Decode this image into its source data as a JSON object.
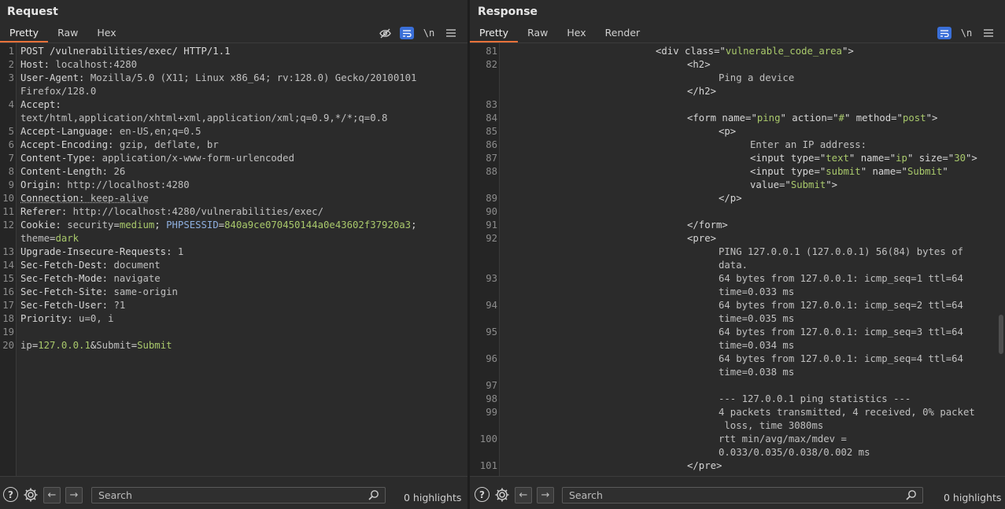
{
  "request": {
    "title": "Request",
    "tabs": [
      "Pretty",
      "Raw",
      "Hex"
    ],
    "tools": [
      "eye-slash",
      "wrap",
      "\\n",
      "menu"
    ],
    "lines": [
      {
        "n": "1",
        "parts": [
          [
            "k",
            "POST /vulnerabilities/exec/ HTTP/1.1"
          ]
        ]
      },
      {
        "n": "2",
        "parts": [
          [
            "k",
            "Host: "
          ],
          [
            "v",
            "localhost:4280"
          ]
        ]
      },
      {
        "n": "3",
        "parts": [
          [
            "k",
            "User-Agent: "
          ],
          [
            "v",
            "Mozilla/5.0 (X11; Linux x86_64; rv:128.0) Gecko/20100101"
          ]
        ]
      },
      {
        "n": "",
        "parts": [
          [
            "v",
            "Firefox/128.0"
          ]
        ]
      },
      {
        "n": "4",
        "parts": [
          [
            "k",
            "Accept: "
          ]
        ]
      },
      {
        "n": "",
        "parts": [
          [
            "v",
            "text/html,application/xhtml+xml,application/xml;q=0.9,*/*;q=0.8"
          ]
        ]
      },
      {
        "n": "5",
        "parts": [
          [
            "k",
            "Accept-Language: "
          ],
          [
            "v",
            "en-US,en;q=0.5"
          ]
        ]
      },
      {
        "n": "6",
        "parts": [
          [
            "k",
            "Accept-Encoding: "
          ],
          [
            "v",
            "gzip, deflate, br"
          ]
        ]
      },
      {
        "n": "7",
        "parts": [
          [
            "k",
            "Content-Type: "
          ],
          [
            "v",
            "application/x-www-form-urlencoded"
          ]
        ]
      },
      {
        "n": "8",
        "parts": [
          [
            "k",
            "Content-Length: "
          ],
          [
            "v",
            "26"
          ]
        ]
      },
      {
        "n": "9",
        "parts": [
          [
            "k",
            "Origin: "
          ],
          [
            "v",
            "http://localhost:4280"
          ]
        ]
      },
      {
        "n": "10",
        "parts": [
          [
            "k",
            "Connection: "
          ],
          [
            "v",
            "keep-alive"
          ]
        ]
      },
      {
        "n": "11",
        "parts": [
          [
            "k",
            "Referer: "
          ],
          [
            "v",
            "http://localhost:4280/vulnerabilities/exec/"
          ]
        ]
      },
      {
        "n": "12",
        "parts": [
          [
            "k",
            "Cookie: "
          ],
          [
            "v",
            "security"
          ],
          [
            "k",
            "="
          ],
          [
            "g",
            "medium"
          ],
          [
            "k",
            "; "
          ],
          [
            "b",
            "PHPSESSID"
          ],
          [
            "k",
            "="
          ],
          [
            "g",
            "840a9ce070450144a0e43602f37920a3"
          ],
          [
            "k",
            ";"
          ]
        ]
      },
      {
        "n": "",
        "parts": [
          [
            "v",
            "theme"
          ],
          [
            "k",
            "="
          ],
          [
            "g",
            "dark"
          ]
        ]
      },
      {
        "n": "13",
        "parts": [
          [
            "k",
            "Upgrade-Insecure-Requests: "
          ],
          [
            "v",
            "1"
          ]
        ]
      },
      {
        "n": "14",
        "parts": [
          [
            "k",
            "Sec-Fetch-Dest: "
          ],
          [
            "v",
            "document"
          ]
        ]
      },
      {
        "n": "15",
        "parts": [
          [
            "k",
            "Sec-Fetch-Mode: "
          ],
          [
            "v",
            "navigate"
          ]
        ]
      },
      {
        "n": "16",
        "parts": [
          [
            "k",
            "Sec-Fetch-Site: "
          ],
          [
            "v",
            "same-origin"
          ]
        ]
      },
      {
        "n": "17",
        "parts": [
          [
            "k",
            "Sec-Fetch-User: "
          ],
          [
            "v",
            "?1"
          ]
        ]
      },
      {
        "n": "18",
        "parts": [
          [
            "k",
            "Priority: "
          ],
          [
            "v",
            "u=0, i"
          ]
        ]
      },
      {
        "n": "19",
        "parts": []
      },
      {
        "n": "20",
        "parts": [
          [
            "v",
            "ip"
          ],
          [
            "k",
            "="
          ],
          [
            "g",
            "127.0.0.1"
          ],
          [
            "k",
            "&"
          ],
          [
            "v",
            "Submit"
          ],
          [
            "k",
            "="
          ],
          [
            "g",
            "Submit"
          ]
        ],
        "current": true
      }
    ],
    "search_placeholder": "Search",
    "highlights": "0 highlights"
  },
  "response": {
    "title": "Response",
    "tabs": [
      "Pretty",
      "Raw",
      "Hex",
      "Render"
    ],
    "tools": [
      "wrap",
      "\\n",
      "menu"
    ],
    "lines": [
      {
        "n": "81",
        "indent": 0,
        "parts": [
          [
            "tag",
            "<div "
          ],
          [
            "attr",
            "class"
          ],
          [
            "tag",
            "=\""
          ],
          [
            "str",
            "vulnerable_code_area"
          ],
          [
            "tag",
            "\">"
          ]
        ]
      },
      {
        "n": "82",
        "indent": 1,
        "parts": [
          [
            "tag",
            "<h2>"
          ]
        ]
      },
      {
        "n": "",
        "indent": 2,
        "parts": [
          [
            "v",
            "Ping a device"
          ]
        ]
      },
      {
        "n": "",
        "indent": 1,
        "parts": [
          [
            "tag",
            "</h2>"
          ]
        ]
      },
      {
        "n": "83",
        "indent": 0,
        "parts": []
      },
      {
        "n": "84",
        "indent": 1,
        "parts": [
          [
            "tag",
            "<form "
          ],
          [
            "attr",
            "name"
          ],
          [
            "tag",
            "=\""
          ],
          [
            "str",
            "ping"
          ],
          [
            "tag",
            "\" "
          ],
          [
            "attr",
            "action"
          ],
          [
            "tag",
            "=\""
          ],
          [
            "str",
            "#"
          ],
          [
            "tag",
            "\" "
          ],
          [
            "attr",
            "method"
          ],
          [
            "tag",
            "=\""
          ],
          [
            "str",
            "post"
          ],
          [
            "tag",
            "\">"
          ]
        ]
      },
      {
        "n": "85",
        "indent": 2,
        "parts": [
          [
            "tag",
            "<p>"
          ]
        ]
      },
      {
        "n": "86",
        "indent": 3,
        "parts": [
          [
            "v",
            "Enter an IP address:"
          ]
        ]
      },
      {
        "n": "87",
        "indent": 3,
        "parts": [
          [
            "tag",
            "<input "
          ],
          [
            "attr",
            "type"
          ],
          [
            "tag",
            "=\""
          ],
          [
            "str",
            "text"
          ],
          [
            "tag",
            "\" "
          ],
          [
            "attr",
            "name"
          ],
          [
            "tag",
            "=\""
          ],
          [
            "str",
            "ip"
          ],
          [
            "tag",
            "\" "
          ],
          [
            "attr",
            "size"
          ],
          [
            "tag",
            "=\""
          ],
          [
            "str",
            "30"
          ],
          [
            "tag",
            "\">"
          ]
        ]
      },
      {
        "n": "88",
        "indent": 3,
        "parts": [
          [
            "tag",
            "<input "
          ],
          [
            "attr",
            "type"
          ],
          [
            "tag",
            "=\""
          ],
          [
            "str",
            "submit"
          ],
          [
            "tag",
            "\" "
          ],
          [
            "attr",
            "name"
          ],
          [
            "tag",
            "=\""
          ],
          [
            "str",
            "Submit"
          ],
          [
            "tag",
            "\""
          ]
        ]
      },
      {
        "n": "",
        "indent": 3,
        "parts": [
          [
            "attr",
            "value"
          ],
          [
            "tag",
            "=\""
          ],
          [
            "str",
            "Submit"
          ],
          [
            "tag",
            "\">"
          ]
        ]
      },
      {
        "n": "89",
        "indent": 2,
        "parts": [
          [
            "tag",
            "</p>"
          ]
        ]
      },
      {
        "n": "90",
        "indent": 0,
        "parts": []
      },
      {
        "n": "91",
        "indent": 1,
        "parts": [
          [
            "tag",
            "</form>"
          ]
        ]
      },
      {
        "n": "92",
        "indent": 1,
        "parts": [
          [
            "tag",
            "<pre>"
          ]
        ]
      },
      {
        "n": "",
        "indent": 2,
        "parts": [
          [
            "v",
            "PING 127.0.0.1 (127.0.0.1) 56(84) bytes of"
          ]
        ]
      },
      {
        "n": "",
        "indent": 2,
        "parts": [
          [
            "v",
            "data."
          ]
        ]
      },
      {
        "n": "93",
        "indent": 2,
        "parts": [
          [
            "v",
            "64 bytes from 127.0.0.1: icmp_seq=1 ttl=64"
          ]
        ]
      },
      {
        "n": "",
        "indent": 2,
        "parts": [
          [
            "v",
            "time=0.033 ms"
          ]
        ]
      },
      {
        "n": "94",
        "indent": 2,
        "parts": [
          [
            "v",
            "64 bytes from 127.0.0.1: icmp_seq=2 ttl=64"
          ]
        ]
      },
      {
        "n": "",
        "indent": 2,
        "parts": [
          [
            "v",
            "time=0.035 ms"
          ]
        ]
      },
      {
        "n": "95",
        "indent": 2,
        "parts": [
          [
            "v",
            "64 bytes from 127.0.0.1: icmp_seq=3 ttl=64"
          ]
        ]
      },
      {
        "n": "",
        "indent": 2,
        "parts": [
          [
            "v",
            "time=0.034 ms"
          ]
        ]
      },
      {
        "n": "96",
        "indent": 2,
        "parts": [
          [
            "v",
            "64 bytes from 127.0.0.1: icmp_seq=4 ttl=64"
          ]
        ]
      },
      {
        "n": "",
        "indent": 2,
        "parts": [
          [
            "v",
            "time=0.038 ms"
          ]
        ]
      },
      {
        "n": "97",
        "indent": 0,
        "parts": []
      },
      {
        "n": "98",
        "indent": 2,
        "parts": [
          [
            "v",
            "--- 127.0.0.1 ping statistics ---"
          ]
        ]
      },
      {
        "n": "99",
        "indent": 2,
        "parts": [
          [
            "v",
            "4 packets transmitted, 4 received, 0% packet"
          ]
        ]
      },
      {
        "n": "",
        "indent": 2,
        "parts": [
          [
            "v",
            " loss, time 3080ms"
          ]
        ]
      },
      {
        "n": "100",
        "indent": 2,
        "parts": [
          [
            "v",
            "rtt min/avg/max/mdev ="
          ]
        ]
      },
      {
        "n": "",
        "indent": 2,
        "parts": [
          [
            "v",
            "0.033/0.035/0.038/0.002 ms"
          ]
        ]
      },
      {
        "n": "101",
        "indent": 1,
        "parts": [
          [
            "tag",
            "</pre>"
          ]
        ]
      }
    ],
    "search_placeholder": "Search",
    "highlights": "0 highlights"
  }
}
